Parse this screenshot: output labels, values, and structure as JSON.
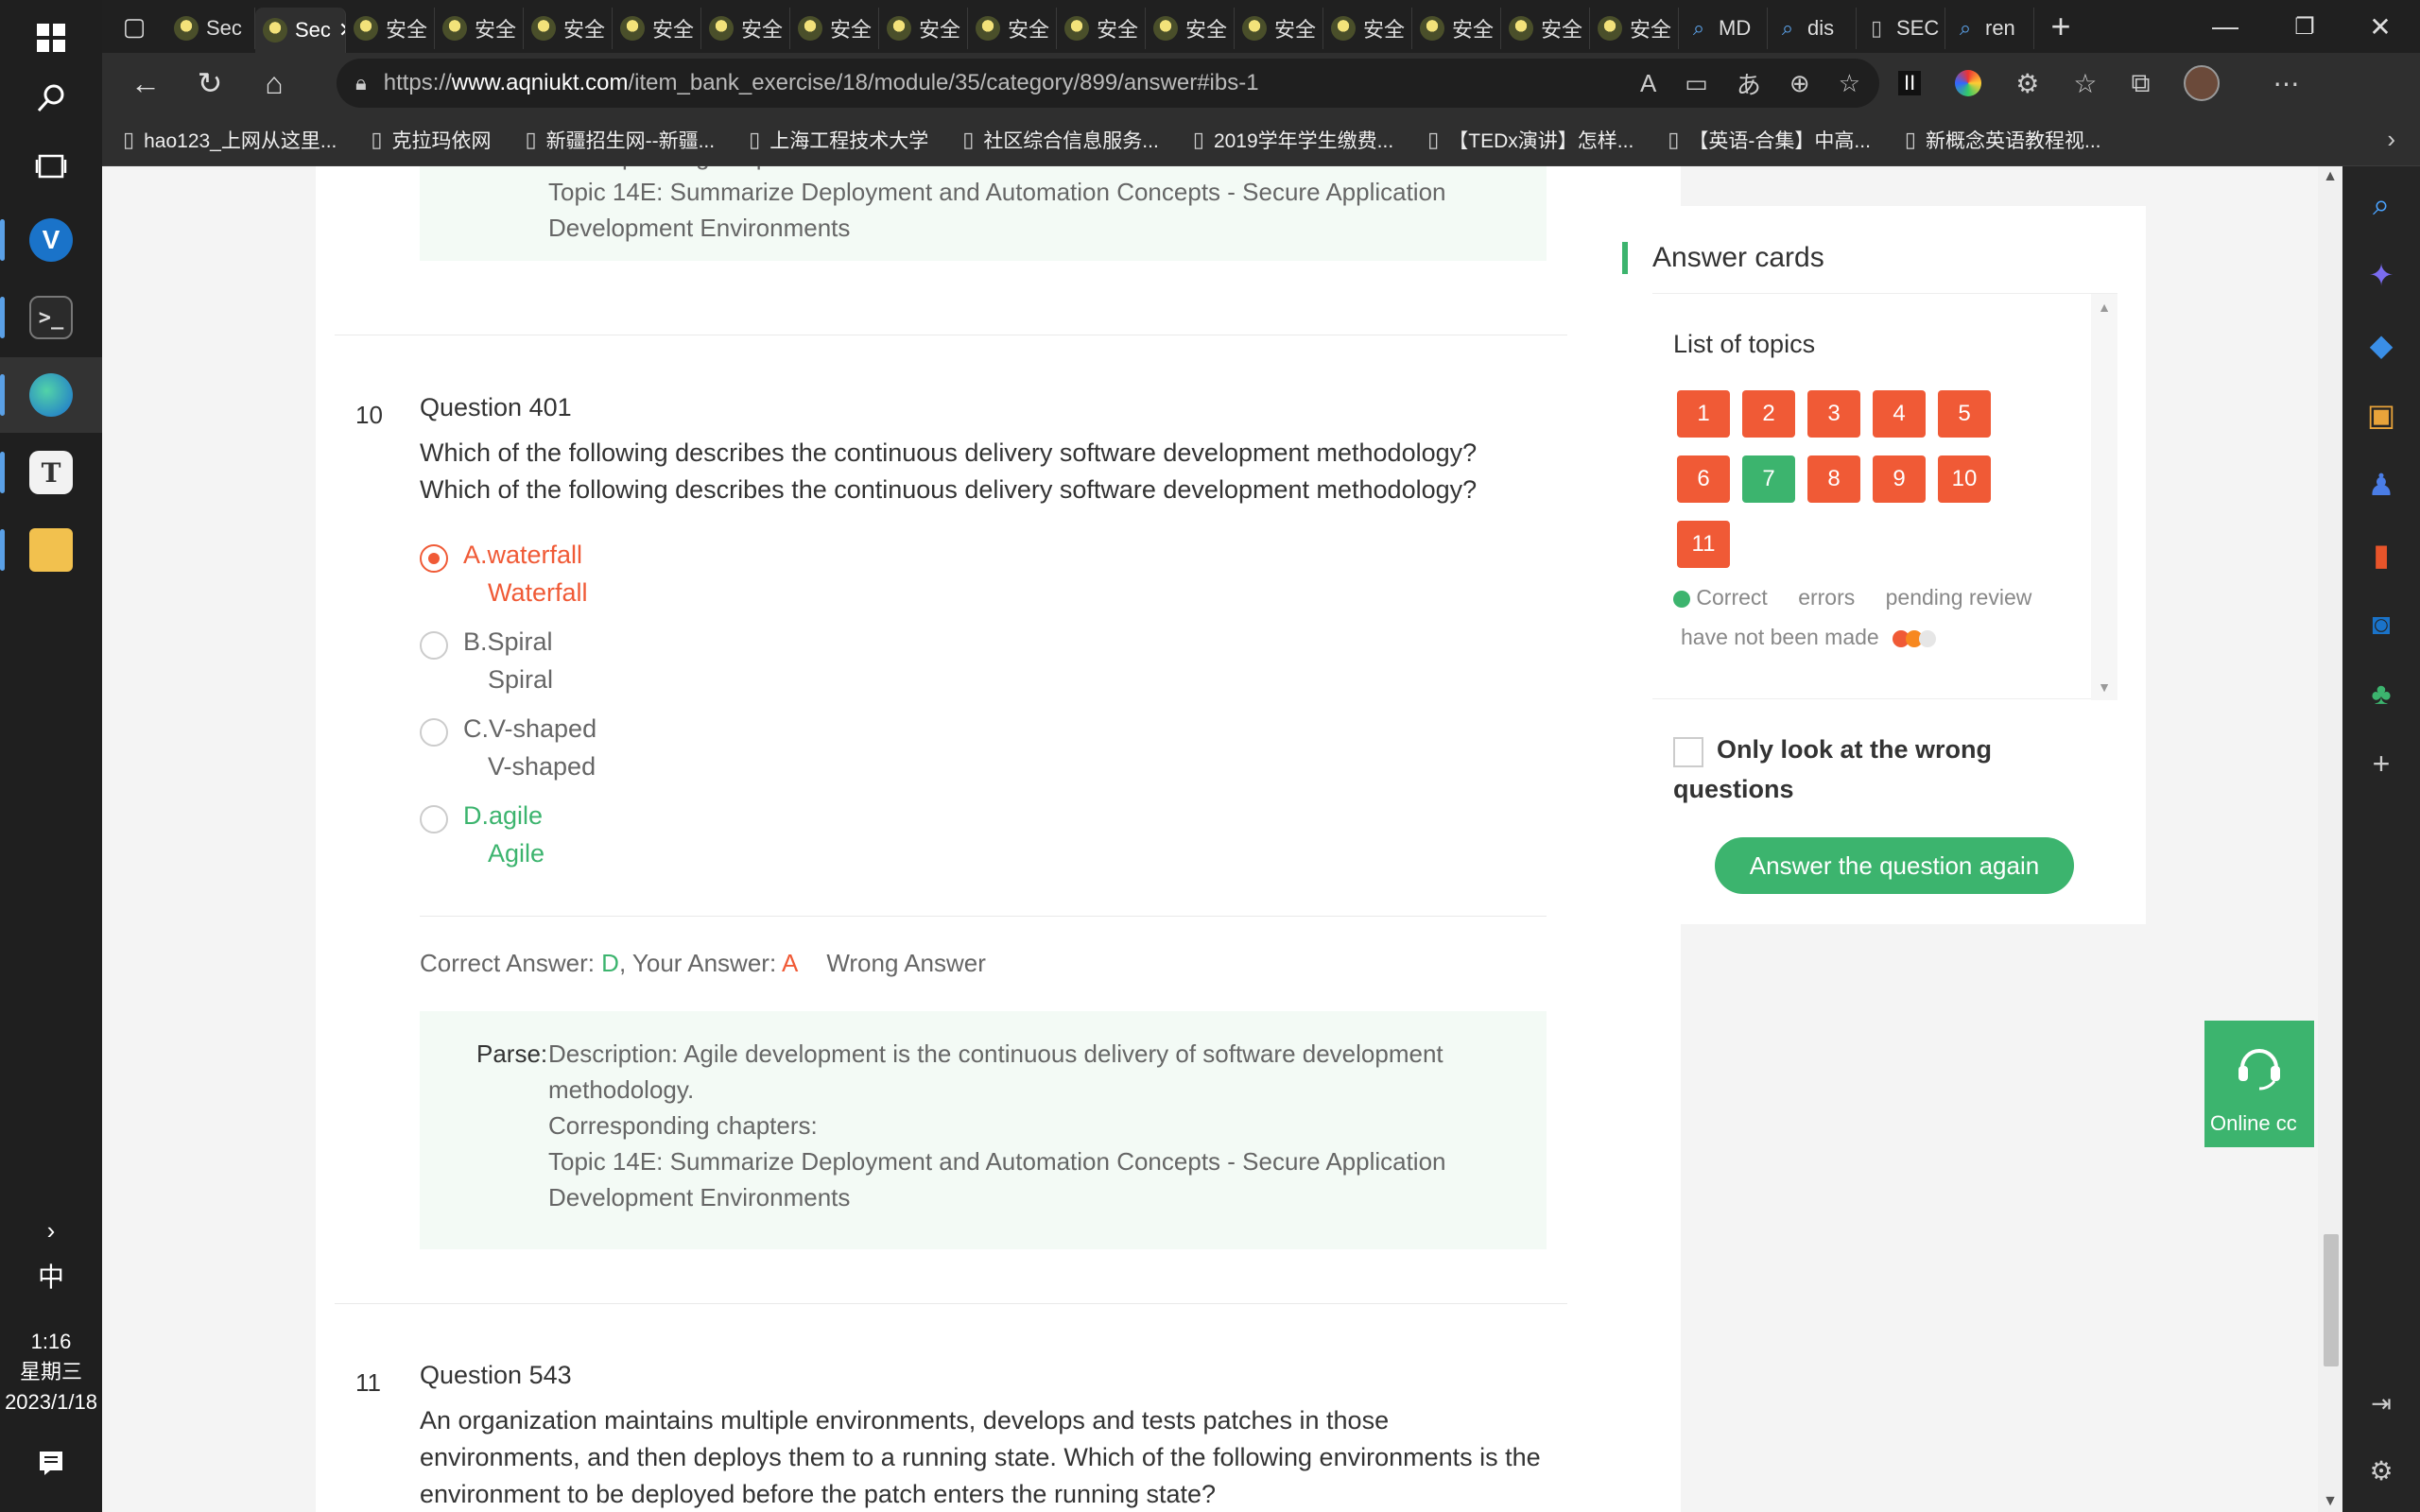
{
  "taskbar": {
    "clock_time": "1:16",
    "clock_day": "星期三",
    "clock_date": "2023/1/18",
    "ime": "中",
    "apps": [
      "vpn-app",
      "terminal-app",
      "edge-app",
      "typora-app",
      "file-explorer-app"
    ]
  },
  "browser": {
    "tabs": [
      {
        "label": "Sec",
        "type": "site"
      },
      {
        "label": "Sec",
        "type": "site",
        "active": true
      },
      {
        "label": "安全",
        "type": "site"
      },
      {
        "label": "安全",
        "type": "site"
      },
      {
        "label": "安全",
        "type": "site"
      },
      {
        "label": "安全",
        "type": "site"
      },
      {
        "label": "安全",
        "type": "site"
      },
      {
        "label": "安全",
        "type": "site"
      },
      {
        "label": "安全",
        "type": "site"
      },
      {
        "label": "安全",
        "type": "site"
      },
      {
        "label": "安全",
        "type": "site"
      },
      {
        "label": "安全",
        "type": "site"
      },
      {
        "label": "安全",
        "type": "site"
      },
      {
        "label": "安全",
        "type": "site"
      },
      {
        "label": "安全",
        "type": "site"
      },
      {
        "label": "安全",
        "type": "site"
      },
      {
        "label": "安全",
        "type": "site"
      },
      {
        "label": "MD",
        "type": "search"
      },
      {
        "label": "dis",
        "type": "search"
      },
      {
        "label": "SEC",
        "type": "doc"
      },
      {
        "label": "ren",
        "type": "search"
      }
    ],
    "url_prefix": "https://",
    "url_host": "www.aqniukt.com",
    "url_path": "/item_bank_exercise/18/module/35/category/899/answer#ibs-1",
    "bookmarks": [
      "hao123_上网从这里...",
      "克拉玛依网",
      "新疆招生网--新疆...",
      "上海工程技术大学",
      "社区综合信息服务...",
      "2019学年学生缴费...",
      "【TEDx演讲】怎样...",
      "【英语-合集】中高...",
      "新概念英语教程视..."
    ]
  },
  "prev_parse": {
    "line_cut": "Corresponding chapters:",
    "line1": "Topic 14E: Summarize Deployment and Automation Concepts - Secure Application",
    "line2": "Development Environments"
  },
  "question10": {
    "num": "10",
    "title": "Question 401",
    "text1": "Which of the following describes the continuous delivery software development methodology?",
    "text2": "Which of the following describes the continuous delivery software development methodology?",
    "options": [
      {
        "main": "A.waterfall",
        "sub": "Waterfall"
      },
      {
        "main": "B.Spiral",
        "sub": "Spiral"
      },
      {
        "main": "C.V-shaped",
        "sub": "V-shaped"
      },
      {
        "main": "D.agile",
        "sub": "Agile"
      }
    ],
    "correct_label": "Correct Answer: ",
    "correct_value": "D",
    "your_label": ", Your Answer: ",
    "your_value": "A",
    "result": "Wrong Answer",
    "parse_label": "Parse:",
    "parse_line1": "Description: Agile development is the continuous delivery of software development",
    "parse_line2": "methodology.",
    "parse_line3": "Corresponding chapters:",
    "parse_line4": "Topic 14E: Summarize Deployment and Automation Concepts - Secure Application",
    "parse_line5": "Development Environments"
  },
  "question11": {
    "num": "11",
    "title": "Question 543",
    "text1": "An organization maintains multiple environments, develops and tests patches in those",
    "text2": "environments, and then deploys them to a running state. Which of the following environments is the",
    "text3": "environment to be deployed before the patch enters the running state?"
  },
  "answer_card": {
    "title": "Answer cards",
    "list_title": "List of topics",
    "numbers": [
      {
        "n": "1",
        "status": "error"
      },
      {
        "n": "2",
        "status": "error"
      },
      {
        "n": "3",
        "status": "error"
      },
      {
        "n": "4",
        "status": "error"
      },
      {
        "n": "5",
        "status": "error"
      },
      {
        "n": "6",
        "status": "error"
      },
      {
        "n": "7",
        "status": "correct"
      },
      {
        "n": "8",
        "status": "error"
      },
      {
        "n": "9",
        "status": "error"
      },
      {
        "n": "10",
        "status": "error"
      },
      {
        "n": "11",
        "status": "error"
      }
    ],
    "legend_correct": "Correct",
    "legend_errors": "errors",
    "legend_pending": "pending review",
    "legend_not_made": "have not been made",
    "checkbox_label": "Only look at the wrong questions",
    "again_button": "Answer the question again",
    "colors": {
      "correct": "#3cb46e",
      "error": "#f05a36"
    }
  },
  "online": {
    "label": "Online cc"
  }
}
